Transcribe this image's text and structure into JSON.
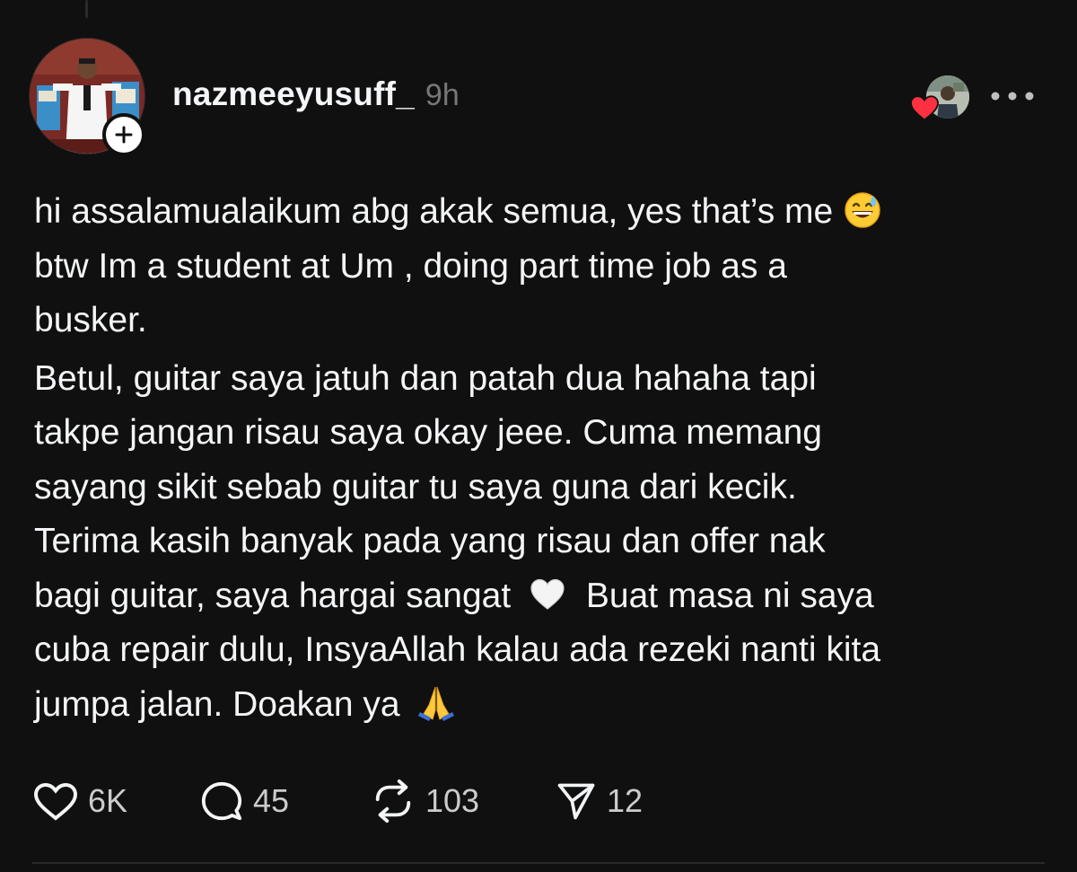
{
  "post": {
    "username": "nazmeeyusuff_",
    "timestamp": "9h",
    "paragraphs": [
      {
        "lines": [
          "hi assalamualaikum abg akak semua, yes that’s me",
          "btw Im a student at Um , doing part time job as a",
          "busker."
        ]
      },
      {
        "lines": [
          "Betul, guitar saya jatuh dan patah dua hahaha tapi",
          "takpe jangan risau saya okay jeee. Cuma memang",
          "sayang sikit sebab guitar tu saya guna dari kecik.",
          "Terima kasih banyak pada yang risau dan offer nak",
          "bagi guitar, saya hargai sangat",
          "Buat masa ni saya",
          "cuba repair dulu, InsyaAllah kalau ada rezeki nanti kita",
          "jumpa jalan. Doakan ya"
        ]
      }
    ],
    "emojis": [
      "grinning-sweat-emoji",
      "white-heart-emoji",
      "folded-hands-emoji"
    ]
  },
  "actions": {
    "likes": "6K",
    "replies": "45",
    "reposts": "103",
    "shares": "12"
  },
  "icons": {
    "follow": "plus-icon",
    "more": "more-horizontal-icon",
    "like": "heart-outline-icon",
    "reply": "speech-bubble-icon",
    "repost": "repost-arrows-icon",
    "share": "paper-plane-icon",
    "liked_badge": "red-heart-icon"
  },
  "colors": {
    "background": "#101010",
    "text": "#f3f5f7",
    "muted": "#777777",
    "heart": "#ff3040"
  }
}
